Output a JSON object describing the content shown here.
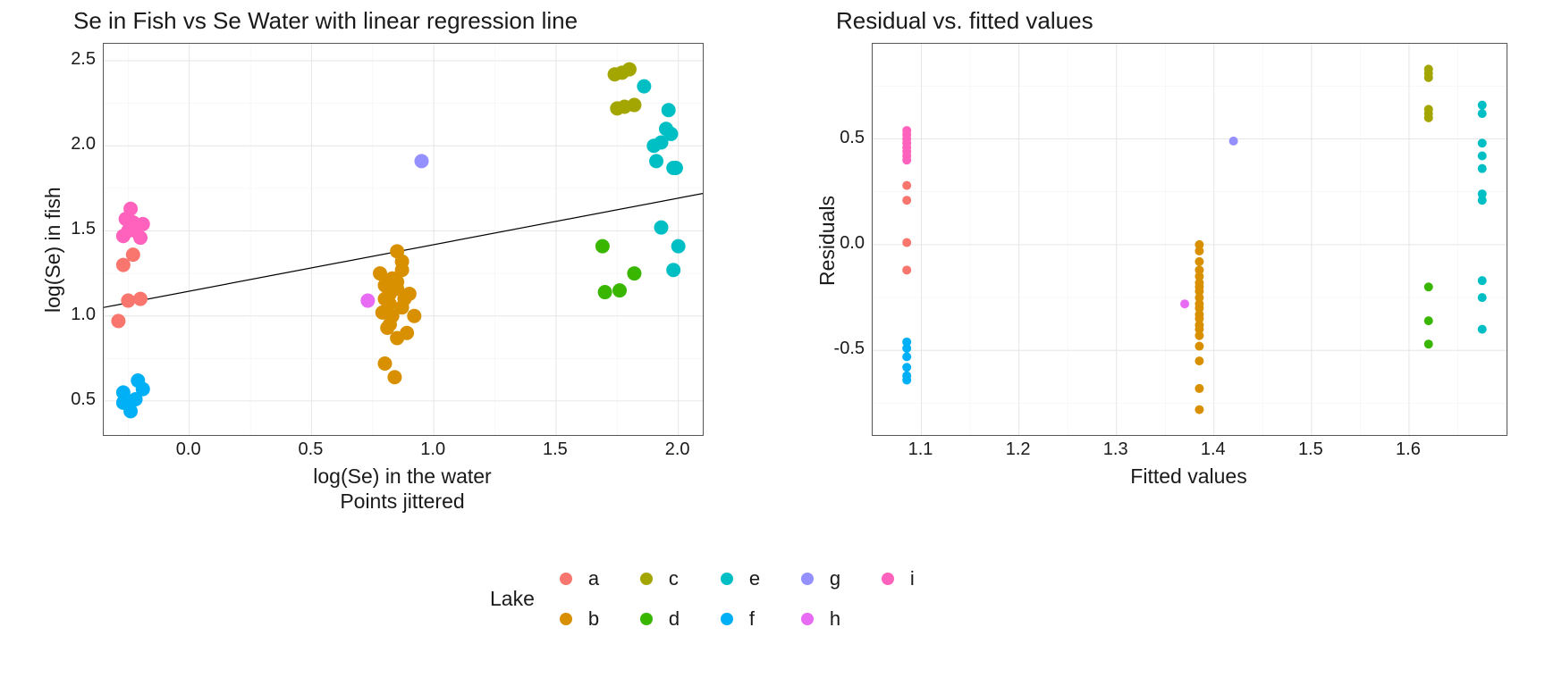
{
  "chart_data": [
    {
      "type": "scatter",
      "title": "Se in Fish vs Se Water with linear regression line",
      "xlabel": "log(Se) in the water\nPoints jittered",
      "ylabel": "log(Se) in fish",
      "xlim": [
        -0.35,
        2.1
      ],
      "ylim": [
        0.3,
        2.6
      ],
      "xticks": [
        0.0,
        0.5,
        1.0,
        1.5,
        2.0
      ],
      "yticks": [
        0.5,
        1.0,
        1.5,
        2.0,
        2.5
      ],
      "regression": {
        "x1": -0.35,
        "y1": 1.05,
        "x2": 2.1,
        "y2": 1.72
      },
      "series": [
        {
          "name": "a",
          "color": "#F8766D",
          "points": [
            [
              -0.25,
              1.09
            ],
            [
              -0.23,
              1.36
            ],
            [
              -0.27,
              1.3
            ],
            [
              -0.29,
              0.97
            ],
            [
              -0.2,
              1.1
            ]
          ]
        },
        {
          "name": "b",
          "color": "#D89000",
          "points": [
            [
              0.85,
              1.38
            ],
            [
              0.8,
              1.1
            ],
            [
              0.82,
              1.13
            ],
            [
              0.83,
              1.22
            ],
            [
              0.85,
              0.87
            ],
            [
              0.87,
              1.32
            ],
            [
              0.83,
              1.0
            ],
            [
              0.8,
              1.18
            ],
            [
              0.82,
              0.95
            ],
            [
              0.87,
              1.05
            ],
            [
              0.9,
              1.13
            ],
            [
              0.92,
              1.0
            ],
            [
              0.8,
              0.72
            ],
            [
              0.84,
              0.64
            ],
            [
              0.87,
              1.27
            ],
            [
              0.85,
              1.16
            ],
            [
              0.82,
              1.07
            ],
            [
              0.78,
              1.25
            ],
            [
              0.88,
              1.1
            ],
            [
              0.85,
              1.2
            ],
            [
              0.89,
              0.9
            ],
            [
              0.79,
              1.02
            ],
            [
              0.81,
              0.93
            ]
          ]
        },
        {
          "name": "c",
          "color": "#A3A500",
          "points": [
            [
              1.75,
              2.22
            ],
            [
              1.78,
              2.23
            ],
            [
              1.82,
              2.24
            ],
            [
              1.77,
              2.43
            ],
            [
              1.8,
              2.45
            ],
            [
              1.74,
              2.42
            ]
          ]
        },
        {
          "name": "d",
          "color": "#39B600",
          "points": [
            [
              1.69,
              1.41
            ],
            [
              1.7,
              1.14
            ],
            [
              1.82,
              1.25
            ],
            [
              1.76,
              1.15
            ]
          ]
        },
        {
          "name": "e",
          "color": "#00BFC4",
          "points": [
            [
              1.86,
              2.35
            ],
            [
              1.95,
              2.1
            ],
            [
              1.96,
              2.21
            ],
            [
              1.93,
              2.02
            ],
            [
              1.98,
              1.87
            ],
            [
              1.91,
              1.91
            ],
            [
              2.0,
              1.41
            ],
            [
              1.93,
              1.52
            ],
            [
              1.98,
              1.27
            ],
            [
              1.97,
              2.07
            ],
            [
              1.9,
              2.0
            ],
            [
              1.99,
              1.87
            ]
          ]
        },
        {
          "name": "f",
          "color": "#00B0F6",
          "points": [
            [
              -0.24,
              0.44
            ],
            [
              -0.27,
              0.55
            ],
            [
              -0.21,
              0.62
            ],
            [
              -0.19,
              0.57
            ],
            [
              -0.27,
              0.49
            ],
            [
              -0.22,
              0.51
            ]
          ]
        },
        {
          "name": "g",
          "color": "#9590FF",
          "points": [
            [
              0.95,
              1.91
            ]
          ]
        },
        {
          "name": "h",
          "color": "#E76BF3",
          "points": [
            [
              0.73,
              1.09
            ]
          ]
        },
        {
          "name": "i",
          "color": "#FF62BC",
          "points": [
            [
              -0.25,
              1.5
            ],
            [
              -0.23,
              1.55
            ],
            [
              -0.27,
              1.47
            ],
            [
              -0.21,
              1.53
            ],
            [
              -0.24,
              1.63
            ],
            [
              -0.22,
              1.5
            ],
            [
              -0.19,
              1.54
            ],
            [
              -0.26,
              1.57
            ],
            [
              -0.23,
              1.52
            ],
            [
              -0.2,
              1.46
            ]
          ]
        }
      ]
    },
    {
      "type": "scatter",
      "title": "Residual vs. fitted values",
      "xlabel": "Fitted values",
      "ylabel": "Residuals",
      "xlim": [
        1.05,
        1.7
      ],
      "ylim": [
        -0.9,
        0.95
      ],
      "xticks": [
        1.1,
        1.2,
        1.3,
        1.4,
        1.5,
        1.6
      ],
      "yticks": [
        -0.5,
        0.0,
        0.5
      ],
      "series": [
        {
          "name": "a",
          "color": "#F8766D",
          "points": [
            [
              1.085,
              0.01
            ],
            [
              1.085,
              0.28
            ],
            [
              1.085,
              0.21
            ],
            [
              1.085,
              -0.12
            ]
          ]
        },
        {
          "name": "b",
          "color": "#D89000",
          "points": [
            [
              1.385,
              -0.03
            ],
            [
              1.385,
              -0.15
            ],
            [
              1.385,
              -0.2
            ],
            [
              1.385,
              -0.25
            ],
            [
              1.385,
              -0.3
            ],
            [
              1.385,
              -0.35
            ],
            [
              1.385,
              -0.4
            ],
            [
              1.385,
              -0.48
            ],
            [
              1.385,
              -0.55
            ],
            [
              1.385,
              -0.68
            ],
            [
              1.385,
              -0.78
            ],
            [
              1.385,
              -0.08
            ],
            [
              1.385,
              -0.18
            ],
            [
              1.385,
              -0.22
            ],
            [
              1.385,
              -0.28
            ],
            [
              1.385,
              -0.33
            ],
            [
              1.385,
              -0.38
            ],
            [
              1.385,
              -0.43
            ],
            [
              1.385,
              -0.12
            ],
            [
              1.385,
              0.0
            ]
          ]
        },
        {
          "name": "c",
          "color": "#A3A500",
          "points": [
            [
              1.62,
              0.6
            ],
            [
              1.62,
              0.62
            ],
            [
              1.62,
              0.64
            ],
            [
              1.62,
              0.79
            ],
            [
              1.62,
              0.81
            ],
            [
              1.62,
              0.83
            ]
          ]
        },
        {
          "name": "d",
          "color": "#39B600",
          "points": [
            [
              1.62,
              -0.2
            ],
            [
              1.62,
              -0.36
            ],
            [
              1.62,
              -0.47
            ]
          ]
        },
        {
          "name": "e",
          "color": "#00BFC4",
          "points": [
            [
              1.675,
              0.66
            ],
            [
              1.675,
              0.62
            ],
            [
              1.675,
              0.48
            ],
            [
              1.675,
              0.36
            ],
            [
              1.675,
              0.21
            ],
            [
              1.675,
              0.24
            ],
            [
              1.675,
              -0.17
            ],
            [
              1.675,
              -0.25
            ],
            [
              1.675,
              -0.4
            ],
            [
              1.675,
              0.42
            ]
          ]
        },
        {
          "name": "f",
          "color": "#00B0F6",
          "points": [
            [
              1.085,
              -0.46
            ],
            [
              1.085,
              -0.49
            ],
            [
              1.085,
              -0.53
            ],
            [
              1.085,
              -0.58
            ],
            [
              1.085,
              -0.62
            ],
            [
              1.085,
              -0.64
            ]
          ]
        },
        {
          "name": "g",
          "color": "#9590FF",
          "points": [
            [
              1.42,
              0.49
            ]
          ]
        },
        {
          "name": "h",
          "color": "#E76BF3",
          "points": [
            [
              1.37,
              -0.28
            ]
          ]
        },
        {
          "name": "i",
          "color": "#FF62BC",
          "points": [
            [
              1.085,
              0.4
            ],
            [
              1.085,
              0.42
            ],
            [
              1.085,
              0.44
            ],
            [
              1.085,
              0.46
            ],
            [
              1.085,
              0.48
            ],
            [
              1.085,
              0.5
            ],
            [
              1.085,
              0.52
            ],
            [
              1.085,
              0.54
            ]
          ]
        }
      ]
    }
  ],
  "legend": {
    "title": "Lake",
    "order": [
      "a",
      "c",
      "e",
      "g",
      "i",
      "b",
      "d",
      "f",
      "h"
    ],
    "colors": {
      "a": "#F8766D",
      "b": "#D89000",
      "c": "#A3A500",
      "d": "#39B600",
      "e": "#00BFC4",
      "f": "#00B0F6",
      "g": "#9590FF",
      "h": "#E76BF3",
      "i": "#FF62BC"
    }
  },
  "text": {
    "left_xlabel_line1": "log(Se) in the water",
    "left_xlabel_line2": "Points jittered"
  }
}
